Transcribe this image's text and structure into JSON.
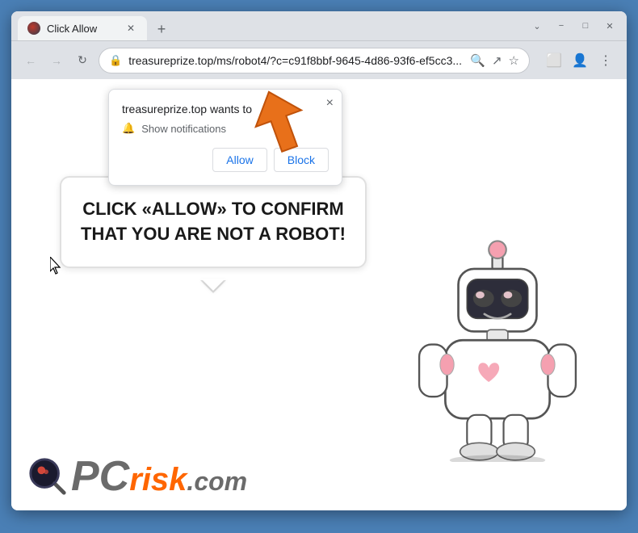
{
  "browser": {
    "tab_title": "Click Allow",
    "url": "treasureprize.top/ms/robot4/?c=c91f8bbf-9645-4d86-93f6-ef5cc3...",
    "window_controls": {
      "minimize": "−",
      "maximize": "□",
      "close": "✕"
    },
    "nav": {
      "back": "←",
      "forward": "→",
      "refresh": "↻"
    }
  },
  "notification_popup": {
    "site_text": "treasureprize.top wants to",
    "bell_label": "Show notifications",
    "allow_label": "Allow",
    "block_label": "Block",
    "close_symbol": "×"
  },
  "speech_bubble": {
    "text": "CLICK «ALLOW» TO CONFIRM THAT YOU ARE NOT A ROBOT!"
  },
  "logo": {
    "pc_text": "PC",
    "risk_text": "risk",
    "com_text": ".com"
  },
  "icons": {
    "lock": "🔒",
    "search": "🔍",
    "share": "↗",
    "bookmark": "☆",
    "extensions": "⬜",
    "profile": "👤",
    "menu": "⋮",
    "bell": "🔔",
    "new_tab": "+"
  }
}
